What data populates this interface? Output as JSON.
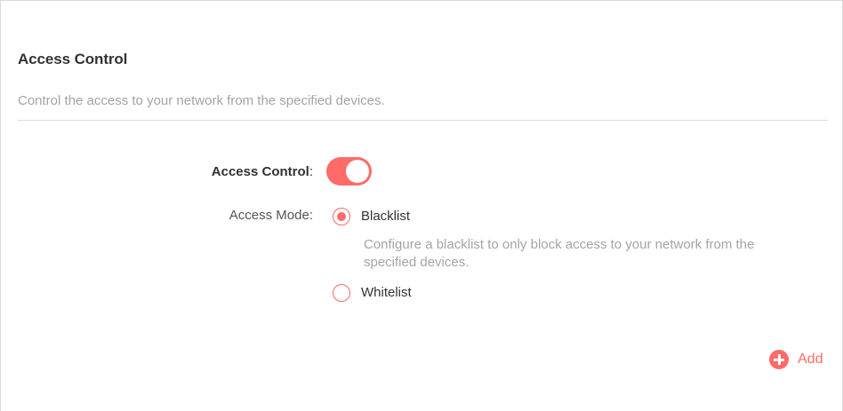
{
  "section": {
    "title": "Access Control",
    "description": "Control the access to your network from the specified devices."
  },
  "form": {
    "access_control_label": "Access Control",
    "access_control_colon": ":",
    "access_control_enabled": true,
    "access_mode_label": "Access Mode:",
    "modes": [
      {
        "label": "Blacklist",
        "checked": true,
        "help": "Configure a blacklist to only block access to your network from the specified devices."
      },
      {
        "label": "Whitelist",
        "checked": false
      }
    ]
  },
  "actions": {
    "add_label": "Add",
    "add_icon": "plus-circle-icon"
  },
  "colors": {
    "accent": "#ff6b68",
    "muted_text": "#a4a4a4"
  }
}
